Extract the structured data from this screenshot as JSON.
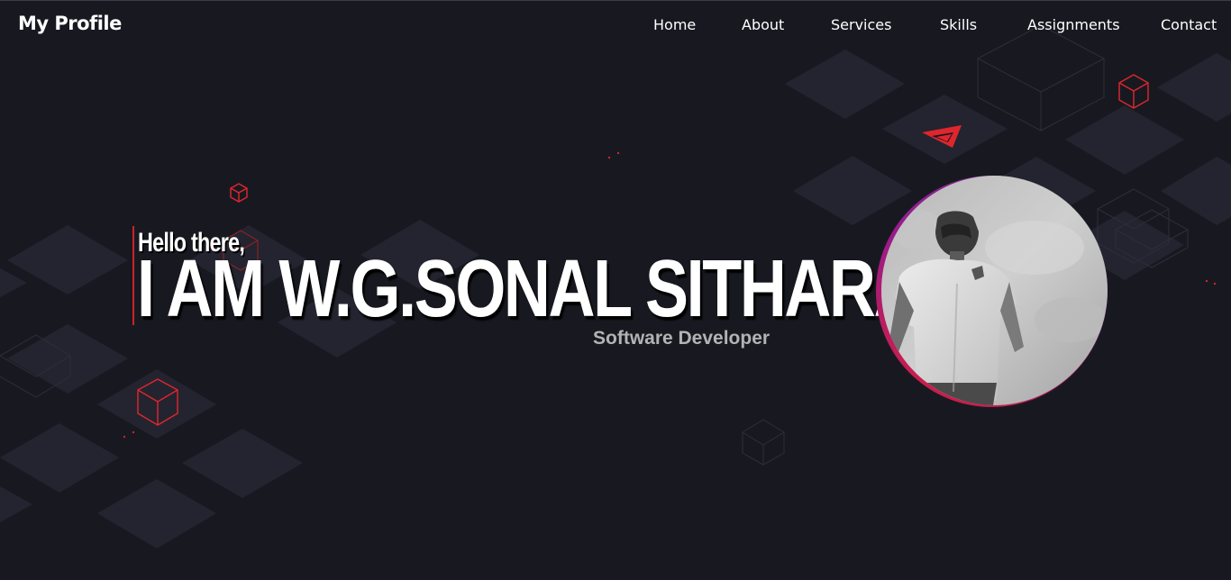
{
  "navbar": {
    "brand": "My Profile",
    "links": [
      {
        "label": "Home"
      },
      {
        "label": "About"
      },
      {
        "label": "Services"
      },
      {
        "label": "Skills"
      },
      {
        "label": "Assignments"
      },
      {
        "label": "Contact"
      }
    ]
  },
  "hero": {
    "greeting": "Hello there,",
    "headline": "I AM W.G.SONAL SITHARA",
    "role": "Software Developer"
  },
  "colors": {
    "background": "#181920",
    "accent_red": "#e0262d",
    "tile": "#23242f",
    "ring_purple": "#7c2aa0",
    "ring_red": "#d61f3a"
  },
  "icons": {
    "profile_photo": "person-photo",
    "paper_plane": "paper-plane-icon",
    "cube": "cube-icon"
  }
}
